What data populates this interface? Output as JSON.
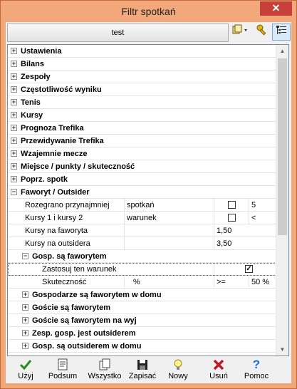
{
  "window": {
    "title": "Filtr spotkań",
    "close": "✕"
  },
  "topbar": {
    "profile_label": "test"
  },
  "tree": {
    "categories": [
      {
        "sign": "+",
        "label": "Ustawienia"
      },
      {
        "sign": "+",
        "label": "Bilans"
      },
      {
        "sign": "+",
        "label": "Zespoły"
      },
      {
        "sign": "+",
        "label": "Częstotliwość wyniku"
      },
      {
        "sign": "+",
        "label": "Tenis"
      },
      {
        "sign": "+",
        "label": "Kursy"
      },
      {
        "sign": "+",
        "label": "Prognoza Trefika"
      },
      {
        "sign": "+",
        "label": "Przewidywanie Trefika"
      },
      {
        "sign": "+",
        "label": "Wzajemnie mecze"
      },
      {
        "sign": "+",
        "label": "Miejsce / punkty / skuteczność"
      },
      {
        "sign": "+",
        "label": "Poprz. spotk"
      },
      {
        "sign": "−",
        "label": "Faworyt / Outsider"
      }
    ],
    "fav_props": [
      {
        "label": "Rozegrano przynajmniej",
        "col2": "spotkań",
        "checked": false,
        "value": "5"
      },
      {
        "label": "Kursy 1 i kursy 2",
        "col2": "warunek",
        "checked": false,
        "value": "<"
      },
      {
        "label": "Kursy na faworyta",
        "col2": "",
        "value": "1,50"
      },
      {
        "label": "Kursy na outsidera",
        "col2": "",
        "value": "3,50"
      }
    ],
    "gosp_group": {
      "sign": "−",
      "label": "Gosp. są faworytem"
    },
    "gosp_props": [
      {
        "label": "Zastosuj ten warunek",
        "checked": true
      },
      {
        "label": "Skuteczność",
        "col2": "%",
        "op": ">=",
        "value": "50 %"
      }
    ],
    "subgroups": [
      {
        "sign": "+",
        "label": "Gospodarze są faworytem w domu"
      },
      {
        "sign": "+",
        "label": "Goście są faworytem"
      },
      {
        "sign": "+",
        "label": "Goście są faworytem na wyj"
      },
      {
        "sign": "+",
        "label": "Zesp. gosp. jest outsiderem"
      },
      {
        "sign": "+",
        "label": "Gosp. są outsiderem w domu"
      }
    ]
  },
  "toolbar": {
    "apply": "Użyj",
    "summary": "Podsum",
    "all": "Wszystko",
    "save": "Zapisać",
    "new": "Nowy",
    "delete": "Usuń",
    "help": "Pomoc"
  },
  "icons": {
    "apply": "check-icon",
    "summary": "document-icon",
    "all": "copy-icon",
    "save": "floppy-icon",
    "new": "lightbulb-icon",
    "delete": "delete-icon",
    "help": "help-icon"
  },
  "colors": {
    "titlebar": "#f2a87a",
    "close": "#c7413a",
    "apply_green": "#1f8f1f",
    "delete_red": "#c0182a",
    "help_blue": "#1f6fd1"
  }
}
